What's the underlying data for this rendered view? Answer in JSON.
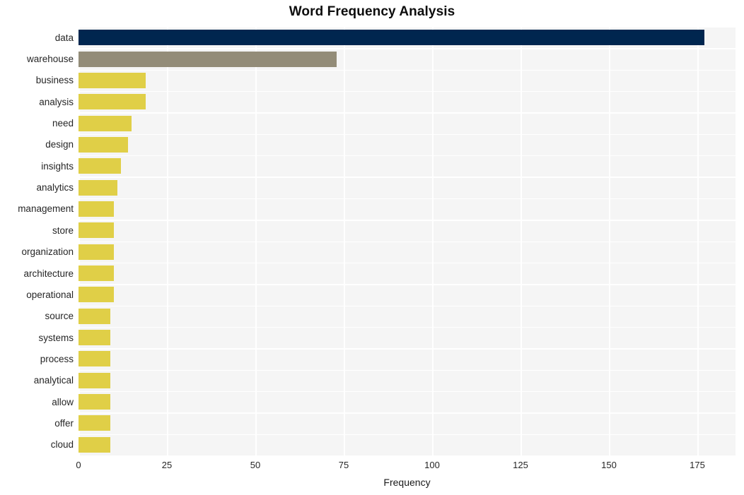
{
  "chart_data": {
    "type": "bar",
    "orientation": "horizontal",
    "title": "Word Frequency Analysis",
    "xlabel": "Frequency",
    "ylabel": "",
    "xlim": [
      0,
      185.8
    ],
    "xticks": [
      0,
      25,
      50,
      75,
      100,
      125,
      150,
      175
    ],
    "xtick_labels": [
      "0",
      "25",
      "50",
      "75",
      "100",
      "125",
      "150",
      "175"
    ],
    "grid": true,
    "grid_color": "#ffffff",
    "plot_background": "#f5f5f5",
    "figure_background": "#ffffff",
    "legend": null,
    "categories": [
      "data",
      "warehouse",
      "business",
      "analysis",
      "need",
      "design",
      "insights",
      "analytics",
      "management",
      "store",
      "organization",
      "architecture",
      "operational",
      "source",
      "systems",
      "process",
      "analytical",
      "allow",
      "offer",
      "cloud"
    ],
    "values": [
      177,
      73,
      19,
      19,
      15,
      14,
      12,
      11,
      10,
      10,
      10,
      10,
      10,
      9,
      9,
      9,
      9,
      9,
      9,
      9
    ],
    "bar_colors": [
      "#00264f",
      "#938c78",
      "#e0cf47",
      "#e0cf47",
      "#e0cf47",
      "#e0cf47",
      "#e0cf47",
      "#e0cf47",
      "#e0cf47",
      "#e0cf47",
      "#e0cf47",
      "#e0cf47",
      "#e0cf47",
      "#e0cf47",
      "#e0cf47",
      "#e0cf47",
      "#e0cf47",
      "#e0cf47",
      "#e0cf47",
      "#e0cf47"
    ]
  }
}
